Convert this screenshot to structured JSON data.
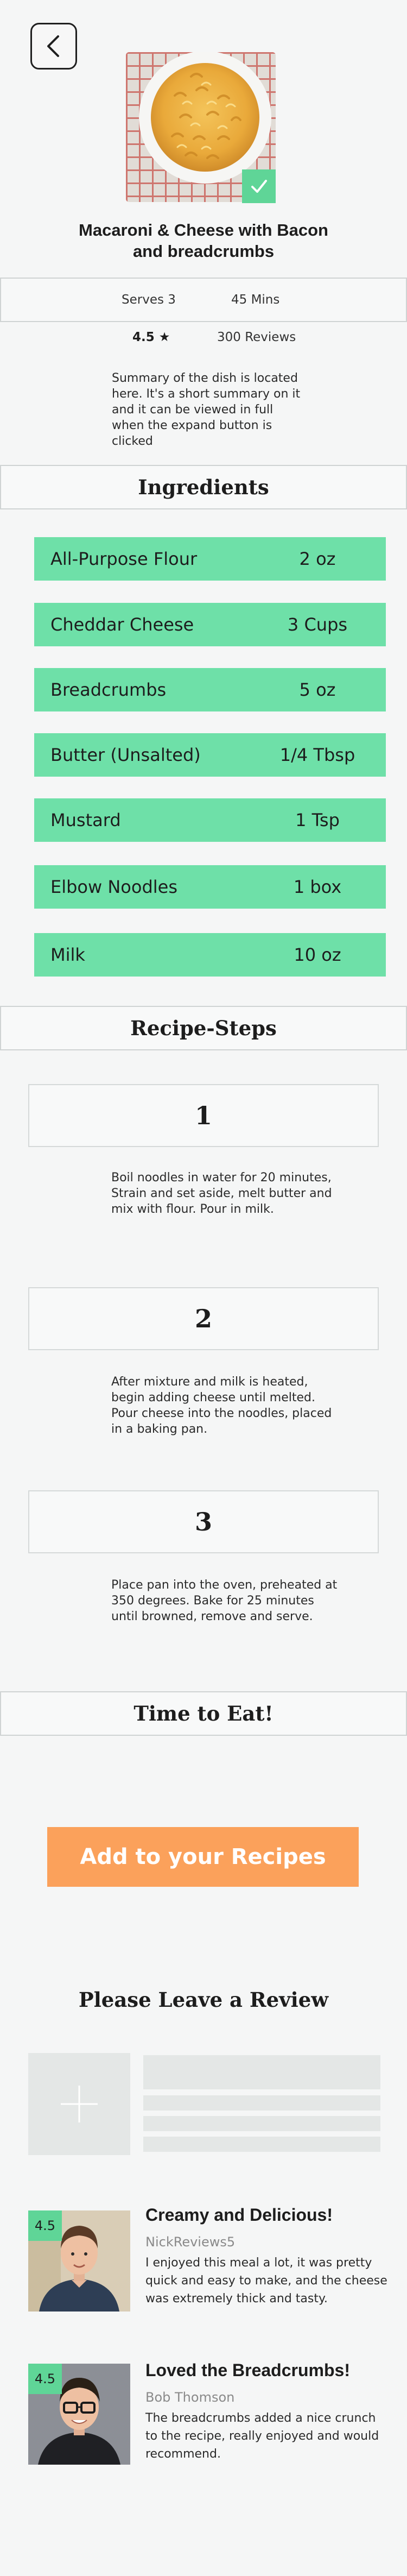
{
  "recipe": {
    "title": "Macaroni & Cheese with Bacon and breadcrumbs",
    "serves": "Serves 3",
    "time": "45 Mins",
    "rating": "4.5 ★",
    "reviews": "300 Reviews",
    "summary": "Summary of the dish is  located here. It's a short summary on it and it can be viewed in full when the expand button is clicked"
  },
  "sections": {
    "ingredients": "Ingredients",
    "steps": "Recipe-Steps",
    "time_to_eat": "Time to Eat!",
    "review_heading": "Please Leave a Review"
  },
  "ingredients": [
    {
      "name": "All-Purpose Flour",
      "qty": "2 oz"
    },
    {
      "name": "Cheddar Cheese",
      "qty": "3 Cups"
    },
    {
      "name": "Breadcrumbs",
      "qty": "5 oz"
    },
    {
      "name": "Butter (Unsalted)",
      "qty": "1/4 Tbsp"
    },
    {
      "name": "Mustard",
      "qty": "1 Tsp"
    },
    {
      "name": "Elbow Noodles",
      "qty": "1 box"
    },
    {
      "name": "Milk",
      "qty": "10 oz"
    }
  ],
  "steps": [
    {
      "number": "1",
      "text": "Boil noodles in water for 20 minutes, Strain and set aside, melt butter and mix with flour. Pour in milk."
    },
    {
      "number": "2",
      "text": "After mixture and milk is heated, begin adding cheese until melted. Pour cheese into the noodles, placed in a baking pan."
    },
    {
      "number": "3",
      "text": "Place pan into the oven, preheated at 350 degrees. Bake for 25 minutes until browned, remove and serve."
    }
  ],
  "add_button": "Add to your Recipes",
  "reviews": [
    {
      "score": "4.5",
      "title": "Creamy and Delicious!",
      "author": "NickReviews5",
      "body": "I enjoyed this meal a lot, it was pretty quick and easy to make, and the cheese was extremely thick and tasty."
    },
    {
      "score": "4.5",
      "title": "Loved the Breadcrumbs!",
      "author": "Bob Thomson",
      "body": "The breadcrumbs added a nice crunch to the recipe, really enjoyed and would recommend."
    }
  ],
  "icons": {
    "back": "chevron-left-icon",
    "check": "checkmark-icon",
    "add_photo": "plus-icon"
  },
  "colors": {
    "accent_green": "#6ee0a8",
    "badge_green": "#5fd597",
    "button_orange": "#fba15b"
  }
}
